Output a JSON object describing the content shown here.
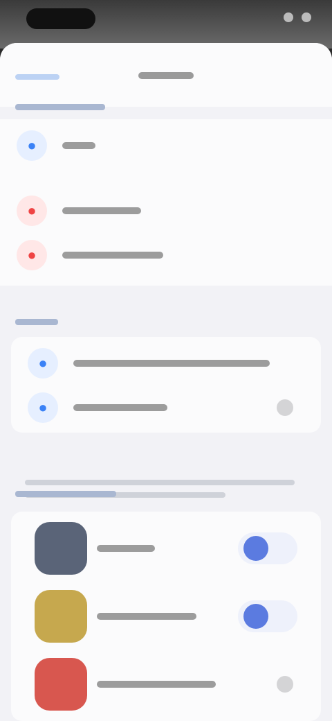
{
  "header": {
    "back_label": "",
    "title": ""
  },
  "sections": {
    "account": {
      "label": ""
    },
    "system": {
      "label": ""
    },
    "connected": {
      "label": ""
    }
  },
  "account_items": [
    {
      "label": "",
      "icon": "user-icon",
      "color": "#3b82f6"
    },
    {
      "label": "",
      "icon": "logout-icon",
      "color": "#ef4444"
    },
    {
      "label": "",
      "icon": "delete-icon",
      "color": "#ef4444"
    }
  ],
  "system_items": [
    {
      "label": "",
      "icon": "bell-icon",
      "color": "#3b82f6"
    },
    {
      "label": "",
      "icon": "settings-icon",
      "color": "#3b82f6"
    }
  ],
  "apps": [
    {
      "label": "",
      "icon": "app-icon-gray",
      "color": "#5a6478",
      "toggled": true
    },
    {
      "label": "",
      "icon": "app-icon-gold",
      "color": "#c6a84e",
      "toggled": true
    },
    {
      "label": "",
      "icon": "app-icon-red",
      "color": "#d8574f",
      "toggled": false
    }
  ],
  "colors": {
    "accent": "#3b82f6",
    "danger": "#ef4444",
    "toggle_on": "#5b7be0",
    "toggle_off": "#e2e3e6",
    "background": "#f2f2f6"
  }
}
